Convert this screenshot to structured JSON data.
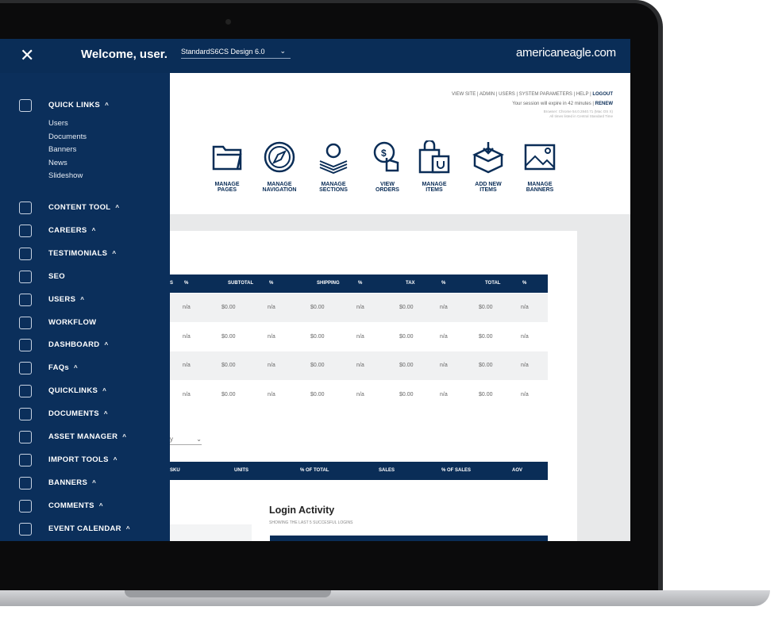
{
  "header": {
    "close_icon": "close-icon",
    "welcome": "Welcome, user.",
    "site_select": "StandardS6CS Design 6.0",
    "brand": "americaneagle.com"
  },
  "util": {
    "links": [
      "VIEW SITE",
      "ADMIN",
      "USERS",
      "SYSTEM PARAMETERS",
      "HELP"
    ],
    "logout": "LOGOUT",
    "session": "Your session will expire in 42 minutes",
    "renew": "RENEW",
    "browser": "Browser: Chrome 54.0.2840.71 (Mac OS X)",
    "timezone": "All times listed in Central Standard Time"
  },
  "tiles": [
    {
      "l1": "MANAGE",
      "l2": "PAGES",
      "icon": "folder-icon"
    },
    {
      "l1": "MANAGE",
      "l2": "NAVIGATION",
      "icon": "compass-icon"
    },
    {
      "l1": "MANAGE",
      "l2": "SECTIONS",
      "icon": "gear-stack-icon"
    },
    {
      "l1": "VIEW",
      "l2": "ORDERS",
      "icon": "dollar-tap-icon"
    },
    {
      "l1": "MANAGE",
      "l2": "ITEMS",
      "icon": "shopping-bag-icon"
    },
    {
      "l1": "ADD NEW",
      "l2": "ITEMS",
      "icon": "box-download-icon"
    },
    {
      "l1": "MANAGE",
      "l2": "BANNERS",
      "icon": "image-icon"
    }
  ],
  "tile_partial": "E",
  "sales_table": {
    "headers": [
      "S",
      "%",
      "SUBTOTAL",
      "%",
      "SHIPPING",
      "%",
      "TAX",
      "%",
      "TOTAL",
      "%"
    ],
    "rows": [
      [
        "",
        "n/a",
        "$0.00",
        "n/a",
        "$0.00",
        "n/a",
        "$0.00",
        "n/a",
        "$0.00",
        "n/a"
      ],
      [
        "",
        "n/a",
        "$0.00",
        "n/a",
        "$0.00",
        "n/a",
        "$0.00",
        "n/a",
        "$0.00",
        "n/a"
      ],
      [
        "",
        "n/a",
        "$0.00",
        "n/a",
        "$0.00",
        "n/a",
        "$0.00",
        "n/a",
        "$0.00",
        "n/a"
      ],
      [
        "",
        "n/a",
        "$0.00",
        "n/a",
        "$0.00",
        "n/a",
        "$0.00",
        "n/a",
        "$0.00",
        "n/a"
      ]
    ]
  },
  "filter_select": "y",
  "sku_table": {
    "headers": [
      "SKU",
      "UNITS",
      "% OF TOTAL",
      "SALES",
      "% OF SALES",
      "AOV"
    ]
  },
  "login_activity": {
    "title": "Login Activity",
    "subtitle": "SHOWING THE LAST 5 SUCCESFUL LOGINS"
  },
  "sidebar": {
    "quick_links": {
      "label": "QUICK LINKS",
      "items": [
        "Users",
        "Documents",
        "Banners",
        "News",
        "Slideshow"
      ]
    },
    "sections": [
      "CONTENT TOOL",
      "CAREERS",
      "TESTIMONIALS",
      "SEO",
      "USERS",
      "WORKFLOW",
      "DASHBOARD",
      "FAQs",
      "QUICKLINKS",
      "DOCUMENTS",
      "ASSET MANAGER",
      "IMPORT TOOLS",
      "BANNERS",
      "COMMENTS",
      "EVENT CALENDAR"
    ],
    "expandable": [
      true,
      true,
      true,
      false,
      true,
      false,
      true,
      true,
      true,
      true,
      true,
      true,
      true,
      true,
      true
    ]
  },
  "colors": {
    "navy": "#0a2d57",
    "sidebar": "#0b2f5b",
    "row_alt": "#f0f1f2"
  }
}
